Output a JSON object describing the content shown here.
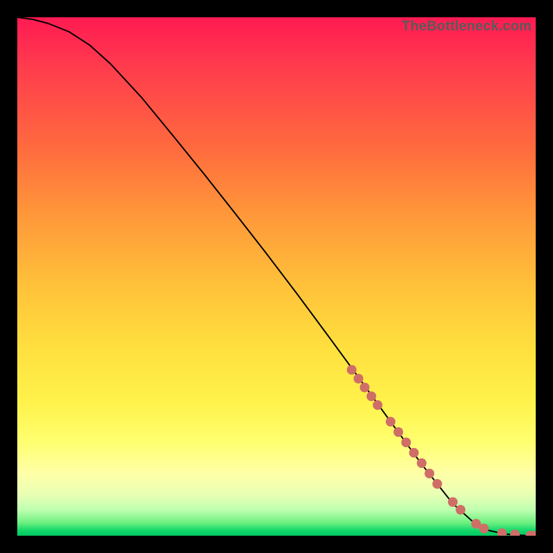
{
  "watermark": "TheBottleneck.com",
  "colors": {
    "curve": "#000000",
    "marker_fill": "#cf6e66",
    "marker_stroke": "#b95b55"
  },
  "chart_data": {
    "type": "line",
    "title": "",
    "xlabel": "",
    "ylabel": "",
    "xlim": [
      0,
      100
    ],
    "ylim": [
      0,
      100
    ],
    "grid": false,
    "series": [
      {
        "name": "curve",
        "x": [
          0,
          3,
          6,
          10,
          14,
          18,
          24,
          30,
          36,
          42,
          48,
          54,
          60,
          66,
          72,
          78,
          84,
          88,
          91,
          94,
          96,
          98,
          100
        ],
        "y": [
          100,
          99.6,
          98.8,
          97.2,
          94.6,
          91.0,
          84.5,
          77.2,
          69.8,
          62.2,
          54.5,
          46.6,
          38.5,
          30.3,
          22.0,
          13.8,
          6.2,
          2.6,
          1.0,
          0.35,
          0.15,
          0.05,
          0.0
        ]
      }
    ],
    "markers": {
      "name": "highlighted-points",
      "x": [
        64.5,
        65.8,
        67.0,
        68.3,
        69.5,
        72.0,
        73.5,
        75.0,
        76.5,
        78.0,
        79.5,
        81.0,
        84.0,
        85.5,
        88.5,
        90.0,
        93.5,
        96.0,
        99.0,
        100.0
      ],
      "y": [
        32.0,
        30.3,
        28.6,
        26.9,
        25.2,
        22.0,
        20.0,
        18.0,
        16.0,
        14.0,
        12.0,
        10.0,
        6.5,
        5.0,
        2.3,
        1.4,
        0.5,
        0.25,
        0.05,
        0.0
      ]
    }
  }
}
